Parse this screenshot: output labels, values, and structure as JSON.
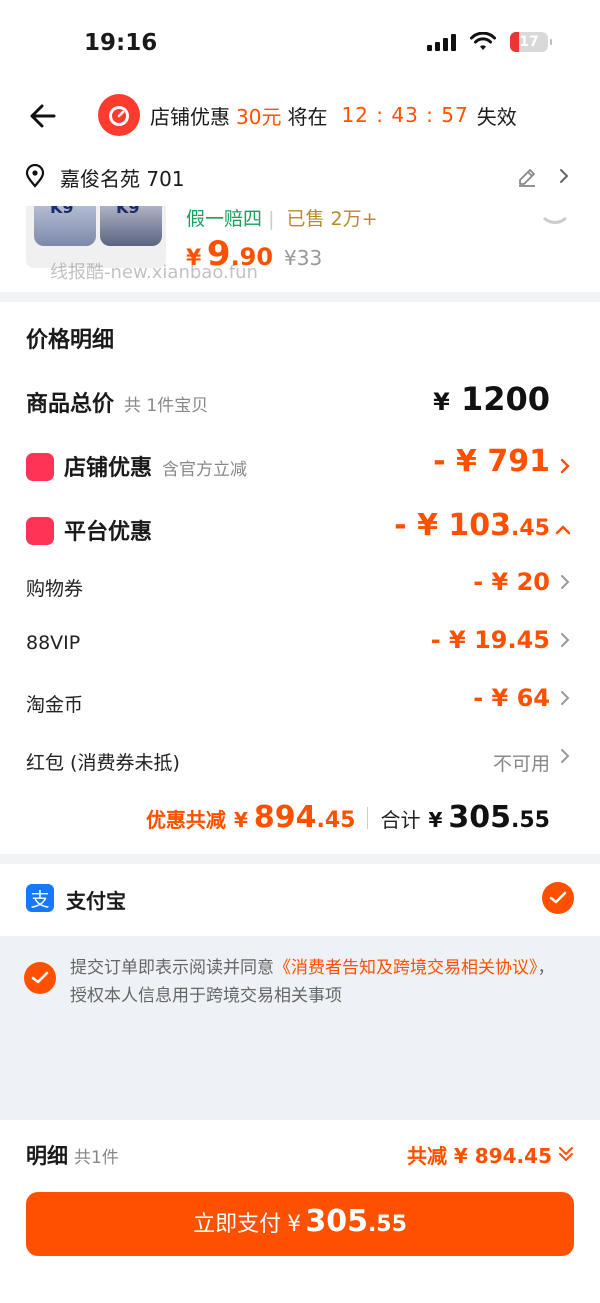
{
  "status_bar": {
    "time": "19:16",
    "battery": "17"
  },
  "nav": {
    "promo_label": "店铺优惠",
    "promo_value": "30元",
    "promo_mid": "将在",
    "countdown": "12 : 43 : 57",
    "promo_suffix": "失效"
  },
  "address": {
    "text": "嘉俊名苑 701"
  },
  "product": {
    "tagline_green": "假一赔四",
    "tagline_sold": "已售 2万+",
    "price_symbol": "¥",
    "price_int": "9",
    "price_dec": ".90",
    "price_old": "¥33",
    "can_label": "K9",
    "watermark": "线报酷-new.xianbao.fun"
  },
  "details": {
    "title": "价格明细",
    "goods_total": {
      "label": "商品总价",
      "sub": "共 1件宝贝",
      "symbol": "¥",
      "amount": "1200"
    },
    "store_discount": {
      "label": "店铺优惠",
      "sub": "含官方立减",
      "amount": "- ¥ 791"
    },
    "platform_discount": {
      "label": "平台优惠",
      "amount_main": "- ¥ 103",
      "amount_dec": ".45"
    },
    "items": [
      {
        "label": "购物券",
        "amount": "- ¥ 20"
      },
      {
        "label": "88VIP",
        "amount": "- ¥ 19.45"
      },
      {
        "label": "淘金币",
        "amount": "- ¥ 64"
      },
      {
        "label": "红包 (消费券未抵)",
        "amount": "不可用"
      }
    ],
    "totals": {
      "saved_label": "优惠共减",
      "saved_symbol": "¥",
      "saved_int": "894",
      "saved_dec": ".45",
      "total_label": "合计",
      "total_symbol": "¥",
      "total_int": "305",
      "total_dec": ".55"
    }
  },
  "payment": {
    "method": "支付宝",
    "icon_glyph": "支"
  },
  "agreement": {
    "prefix": "提交订单即表示阅读并同意",
    "link": "《消费者告知及跨境交易相关协议》",
    "suffix": "，授权本人信息用于跨境交易相关事项"
  },
  "bottom": {
    "label": "明细",
    "count": "共1件",
    "saved": "共减 ¥ 894.45",
    "pay_label": "立即支付",
    "pay_symbol": "¥",
    "pay_int": "305",
    "pay_dec": ".55"
  },
  "colors": {
    "accent": "#ff5000",
    "alipay": "#1677ff",
    "badge": "#ff3355"
  }
}
